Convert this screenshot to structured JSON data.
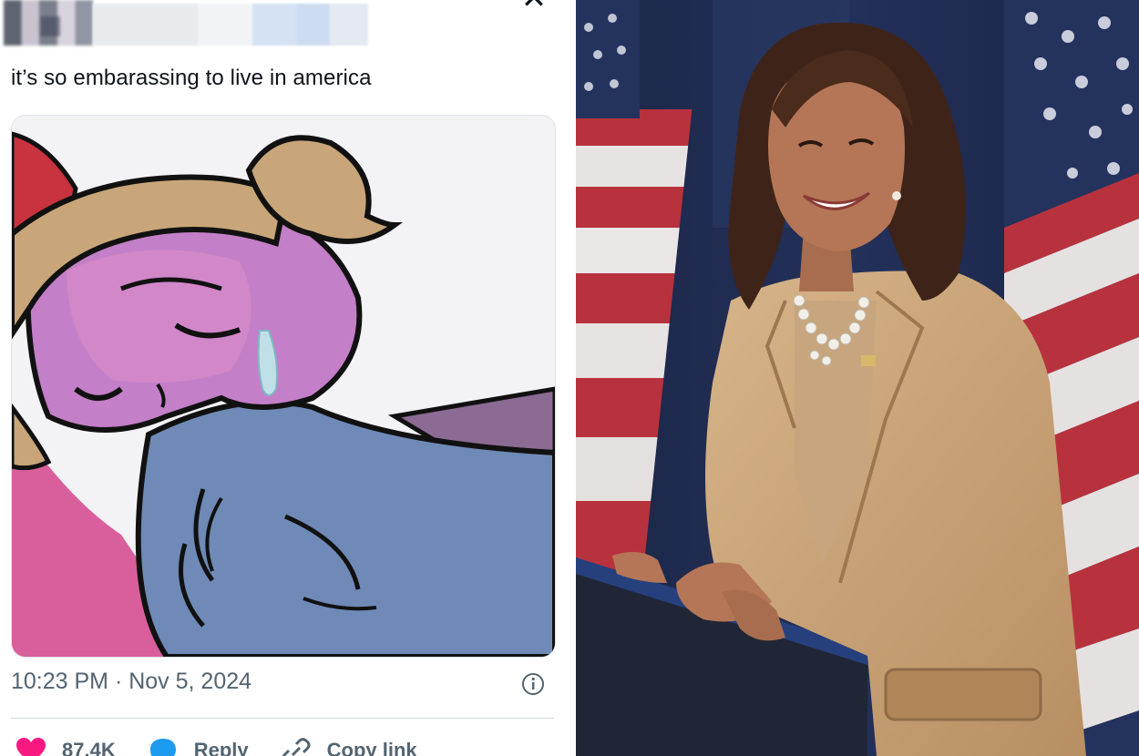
{
  "tweet": {
    "text": "it’s so embarassing to live in america",
    "timestamp": "10:23 PM · Nov 5, 2024",
    "media": {
      "icon": "crying-cartoon-image"
    },
    "actions": [
      {
        "label": "87.4K",
        "icon": "heart-icon",
        "color": "#f91880"
      },
      {
        "label": "Reply",
        "icon": "reply-icon",
        "color": "#1d9bf0"
      },
      {
        "label": "Copy link",
        "icon": "link-icon",
        "color": "#536471"
      }
    ],
    "info_icon": "info-icon",
    "logo_icon": "x-logo-icon"
  },
  "photo": {
    "icon": "smiling-woman-at-podium-photo",
    "colors": {
      "flag_red": "#b8323d",
      "flag_blue": "#1f2d55",
      "blazer": "#c9a47b"
    }
  }
}
